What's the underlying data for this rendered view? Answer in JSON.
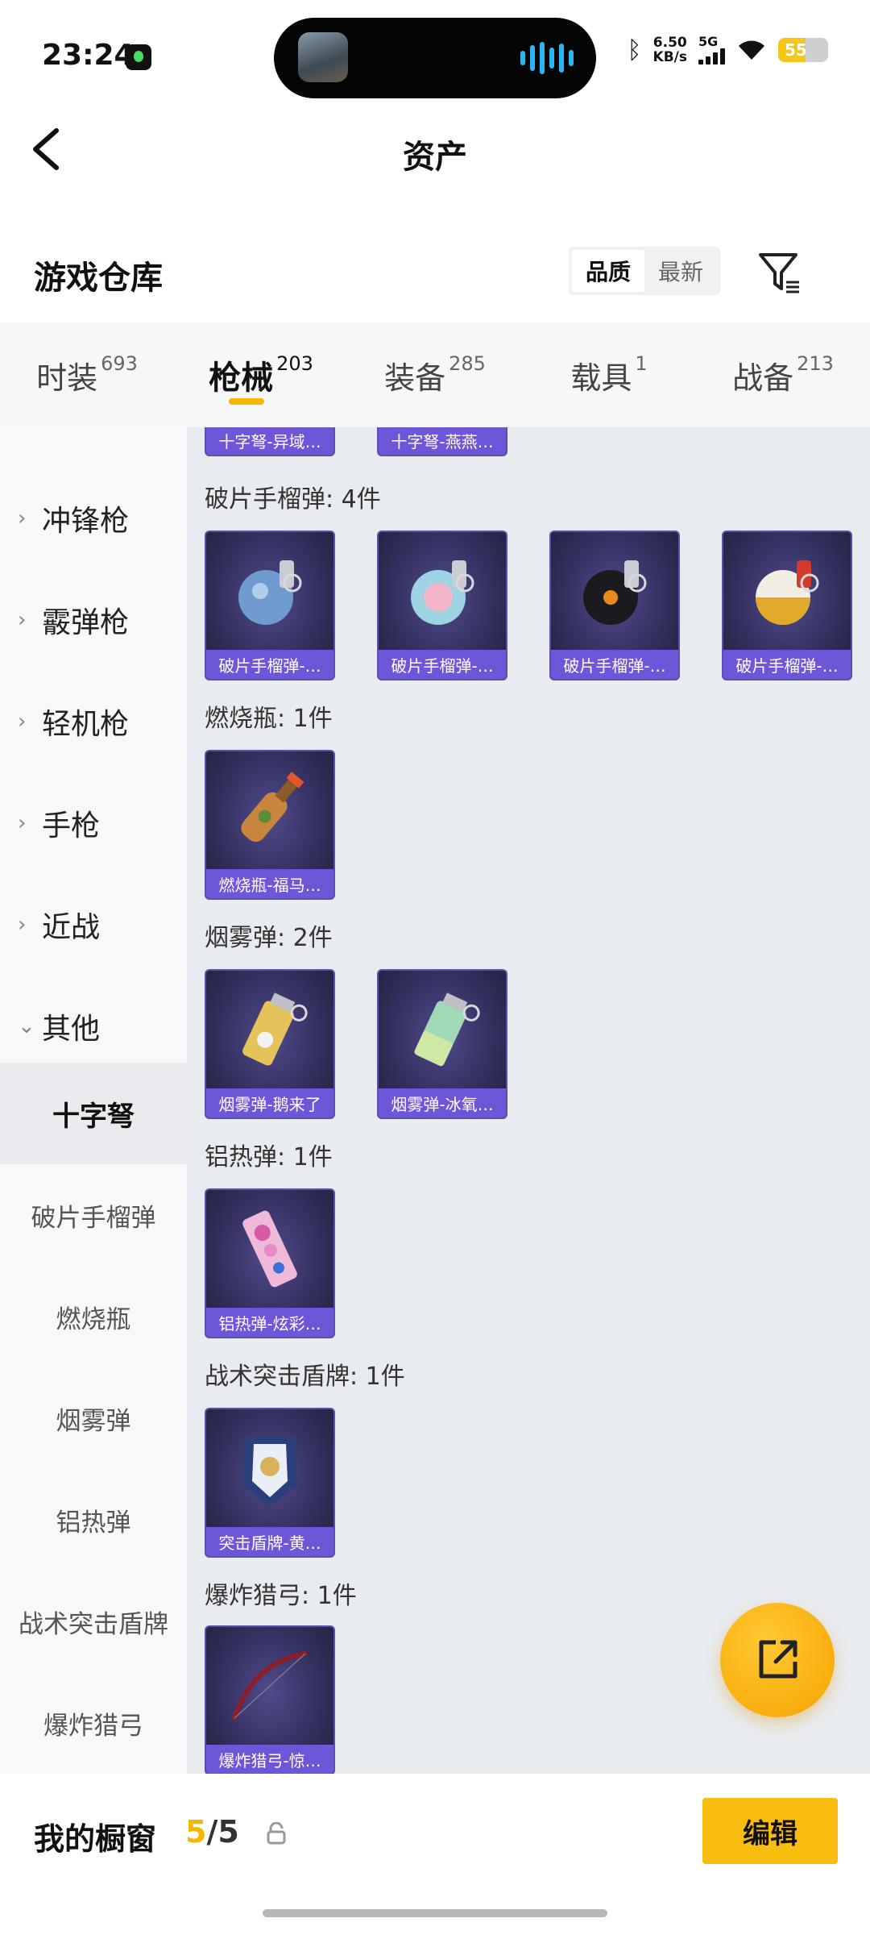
{
  "status_bar": {
    "time": "23:24",
    "net_speed_value": "6.50",
    "net_speed_unit": "KB/s",
    "network_type": "5G",
    "battery": "55",
    "battery_level": 0.55
  },
  "header": {
    "title": "资产"
  },
  "section": {
    "title": "游戏仓库",
    "sort_options": [
      "品质",
      "最新"
    ],
    "active_sort": "品质"
  },
  "tabs": [
    {
      "label": "时装",
      "count": "693"
    },
    {
      "label": "枪械",
      "count": "203"
    },
    {
      "label": "装备",
      "count": "285"
    },
    {
      "label": "载具",
      "count": "1"
    },
    {
      "label": "战备",
      "count": "213"
    }
  ],
  "active_tab": "枪械",
  "sidebar": {
    "categories": [
      {
        "label": "冲锋枪",
        "chevron": "›"
      },
      {
        "label": "霰弹枪",
        "chevron": "›"
      },
      {
        "label": "轻机枪",
        "chevron": "›"
      },
      {
        "label": "手枪",
        "chevron": "›"
      },
      {
        "label": "近战",
        "chevron": "›"
      },
      {
        "label": "其他",
        "chevron": "⌄"
      }
    ],
    "subcategories": [
      "十字弩",
      "破片手榴弹",
      "燃烧瓶",
      "烟雾弹",
      "铝热弹",
      "战术突击盾牌",
      "爆炸猎弓"
    ],
    "active_sub": "十字弩"
  },
  "groups": [
    {
      "title": "",
      "items": [
        "十字弩-异域…",
        "十字弩-燕燕…"
      ]
    },
    {
      "title": "破片手榴弹: 4件",
      "items": [
        "破片手榴弹-…",
        "破片手榴弹-…",
        "破片手榴弹-…",
        "破片手榴弹-…"
      ]
    },
    {
      "title": "燃烧瓶: 1件",
      "items": [
        "燃烧瓶-福马…"
      ]
    },
    {
      "title": "烟雾弹: 2件",
      "items": [
        "烟雾弹-鹅来了",
        "烟雾弹-冰氧…"
      ]
    },
    {
      "title": "铝热弹: 1件",
      "items": [
        "铝热弹-炫彩…"
      ]
    },
    {
      "title": "战术突击盾牌: 1件",
      "items": [
        "突击盾牌-黄…"
      ]
    },
    {
      "title": "爆炸猎弓: 1件",
      "items": [
        "爆炸猎弓-惊…"
      ]
    }
  ],
  "footer": {
    "title": "我的橱窗",
    "count_current": "5",
    "count_sep": "/",
    "count_total": "5",
    "edit_label": "编辑"
  },
  "icons": {
    "back": "chevron-left-icon",
    "filter": "filter-icon",
    "fab": "share-icon",
    "lock": "lock-icon"
  },
  "colors": {
    "accent": "#f5b700",
    "item_label_bg": "#6d56d8",
    "item_bg": "#34305f",
    "main_bg": "#e8ebef"
  }
}
